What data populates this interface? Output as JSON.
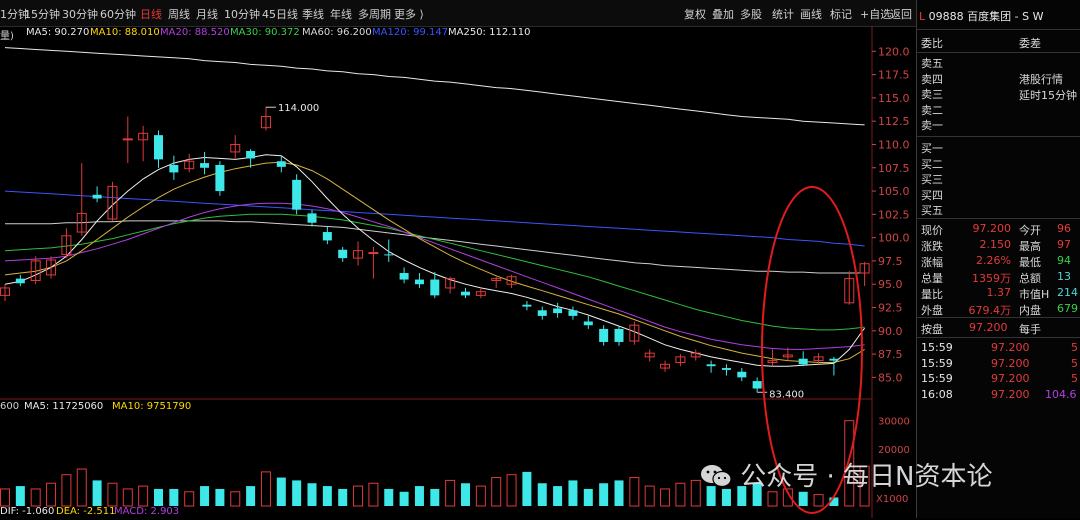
{
  "periods": [
    {
      "label": "1分钟",
      "x": 0,
      "active": false
    },
    {
      "label": "15分钟",
      "x": 24,
      "active": false
    },
    {
      "label": "30分钟",
      "x": 62,
      "active": false
    },
    {
      "label": "60分钟",
      "x": 100,
      "active": false
    },
    {
      "label": "日线",
      "x": 140,
      "active": true
    },
    {
      "label": "周线",
      "x": 168,
      "active": false
    },
    {
      "label": "月线",
      "x": 196,
      "active": false
    },
    {
      "label": "10分钟",
      "x": 224,
      "active": false
    },
    {
      "label": "45日线",
      "x": 262,
      "active": false
    },
    {
      "label": "季线",
      "x": 302,
      "active": false
    },
    {
      "label": "年线",
      "x": 330,
      "active": false
    },
    {
      "label": "多周期",
      "x": 358,
      "active": false
    },
    {
      "label": "更多 ⟩",
      "x": 394,
      "active": false
    }
  ],
  "tools": [
    "复权",
    "叠加",
    "多股",
    "统计",
    "画线",
    "标记",
    "+自选",
    "返回"
  ],
  "ma": {
    "prefix": "量)",
    "ma5": "MA5: 90.270",
    "ma10": "MA10: 88.010",
    "ma20": "MA20: 88.520",
    "ma30": "MA30: 90.372",
    "ma60": "MA60: 96.200",
    "ma120": "MA120: 99.147",
    "ma250": "MA250: 112.110"
  },
  "vol_ma": {
    "vol": "600",
    "ma5": "MA5: 11725060",
    "ma10": "MA10: 9751790"
  },
  "macd": {
    "dif": "DIF: -1.060",
    "dea": "DEA: -2.511",
    "macd": "MACD: 2.903"
  },
  "price_labels": {
    "high": "114.000",
    "low": "83.400"
  },
  "panel": {
    "code": "09888 百度集团 - S W",
    "commission_ratio": "委比",
    "commission_diff": "委差",
    "sell_levels": [
      "卖五",
      "卖四",
      "卖三",
      "卖二",
      "卖一"
    ],
    "buy_levels": [
      "买一",
      "买二",
      "买三",
      "买四",
      "买五"
    ],
    "market_note": "港股行情",
    "delay_note": "延时15分钟",
    "quote": [
      {
        "l1": "现价",
        "v1": "97.200",
        "l2": "今开",
        "v2": "96"
      },
      {
        "l1": "涨跌",
        "v1": "2.150",
        "l2": "最高",
        "v2": "97"
      },
      {
        "l1": "涨幅",
        "v1": "2.26%",
        "l2": "最低",
        "v2": "94"
      },
      {
        "l1": "总量",
        "v1": "1359万",
        "l2": "总额",
        "v2": "13"
      },
      {
        "l1": "量比",
        "v1": "1.37",
        "l2": "市值H",
        "v2": "214"
      },
      {
        "l1": "外盘",
        "v1": "679.4万",
        "l2": "内盘",
        "v2": "679"
      }
    ],
    "auction": {
      "l1": "按盘",
      "v1": "97.200",
      "l2": "每手"
    },
    "ticks": [
      {
        "time": "15:59",
        "price": "97.200",
        "vol": "5"
      },
      {
        "time": "15:59",
        "price": "97.200",
        "vol": "5"
      },
      {
        "time": "15:59",
        "price": "97.200",
        "vol": "5"
      },
      {
        "time": "16:08",
        "price": "97.200",
        "vol": "104.6"
      }
    ]
  },
  "price_axis": [
    "120.0",
    "117.5",
    "115.0",
    "112.5",
    "110.0",
    "107.5",
    "105.0",
    "102.5",
    "100.0",
    "97.5",
    "95.0",
    "92.5",
    "90.0",
    "87.5",
    "85.0"
  ],
  "vol_axis": [
    "30000",
    "20000",
    "X1000"
  ],
  "watermark": "公众号 · 每日N资本论",
  "chart_data": {
    "type": "candlestick",
    "y_range": [
      83,
      121
    ],
    "candles": [
      {
        "o": 93.8,
        "c": 94.6,
        "h": 95.0,
        "l": 93.2
      },
      {
        "o": 95.6,
        "c": 95.1,
        "h": 96.0,
        "l": 94.8
      },
      {
        "o": 95.4,
        "c": 97.5,
        "h": 98.0,
        "l": 95.0
      },
      {
        "o": 96.0,
        "c": 97.6,
        "h": 98.0,
        "l": 95.6
      },
      {
        "o": 98.2,
        "c": 100.2,
        "h": 101.0,
        "l": 97.8
      },
      {
        "o": 100.6,
        "c": 102.6,
        "h": 108.0,
        "l": 100.2
      },
      {
        "o": 104.6,
        "c": 104.2,
        "h": 105.5,
        "l": 103.8
      },
      {
        "o": 102.0,
        "c": 105.5,
        "h": 106.0,
        "l": 101.8
      },
      {
        "o": 110.6,
        "c": 110.6,
        "h": 113.0,
        "l": 108.0
      },
      {
        "o": 110.5,
        "c": 111.2,
        "h": 112.0,
        "l": 108.2
      },
      {
        "o": 111.0,
        "c": 108.4,
        "h": 111.5,
        "l": 107.5
      },
      {
        "o": 107.8,
        "c": 107.0,
        "h": 108.8,
        "l": 106.2
      },
      {
        "o": 107.4,
        "c": 108.2,
        "h": 109.0,
        "l": 107.0
      },
      {
        "o": 108.0,
        "c": 107.5,
        "h": 109.2,
        "l": 106.8
      },
      {
        "o": 107.8,
        "c": 105.0,
        "h": 108.2,
        "l": 104.5
      },
      {
        "o": 109.2,
        "c": 110.0,
        "h": 111.0,
        "l": 108.5
      },
      {
        "o": 109.3,
        "c": 108.5,
        "h": 109.5,
        "l": 107.5
      },
      {
        "o": 111.8,
        "c": 113.0,
        "h": 114.0,
        "l": 111.5
      },
      {
        "o": 108.2,
        "c": 107.6,
        "h": 108.8,
        "l": 107.0
      },
      {
        "o": 106.2,
        "c": 103.0,
        "h": 106.8,
        "l": 102.5
      },
      {
        "o": 102.6,
        "c": 101.6,
        "h": 103.0,
        "l": 101.2
      },
      {
        "o": 100.6,
        "c": 99.7,
        "h": 101.2,
        "l": 99.3
      },
      {
        "o": 98.7,
        "c": 97.8,
        "h": 99.0,
        "l": 97.4
      },
      {
        "o": 97.8,
        "c": 98.6,
        "h": 99.6,
        "l": 97.0
      },
      {
        "o": 98.4,
        "c": 98.4,
        "h": 99.0,
        "l": 95.6
      },
      {
        "o": 98.2,
        "c": 98.1,
        "h": 99.8,
        "l": 97.4
      },
      {
        "o": 96.2,
        "c": 95.5,
        "h": 96.8,
        "l": 95.1
      },
      {
        "o": 95.5,
        "c": 95.0,
        "h": 96.2,
        "l": 94.6
      },
      {
        "o": 95.5,
        "c": 93.8,
        "h": 96.3,
        "l": 93.5
      },
      {
        "o": 94.6,
        "c": 95.6,
        "h": 95.8,
        "l": 94.0
      },
      {
        "o": 94.2,
        "c": 93.8,
        "h": 94.6,
        "l": 93.5
      },
      {
        "o": 93.8,
        "c": 94.2,
        "h": 94.6,
        "l": 93.5
      },
      {
        "o": 95.4,
        "c": 95.6,
        "h": 95.8,
        "l": 94.6
      },
      {
        "o": 95.0,
        "c": 95.8,
        "h": 96.0,
        "l": 94.6
      },
      {
        "o": 92.8,
        "c": 92.6,
        "h": 93.2,
        "l": 92.2
      },
      {
        "o": 92.2,
        "c": 91.6,
        "h": 92.6,
        "l": 91.2
      },
      {
        "o": 92.4,
        "c": 91.9,
        "h": 93.0,
        "l": 91.4
      },
      {
        "o": 92.2,
        "c": 91.6,
        "h": 92.6,
        "l": 91.2
      },
      {
        "o": 91.0,
        "c": 90.6,
        "h": 91.6,
        "l": 90.2
      },
      {
        "o": 90.2,
        "c": 88.8,
        "h": 90.6,
        "l": 88.4
      },
      {
        "o": 90.2,
        "c": 88.8,
        "h": 90.5,
        "l": 88.4
      },
      {
        "o": 88.9,
        "c": 90.6,
        "h": 91.0,
        "l": 88.5
      },
      {
        "o": 87.2,
        "c": 87.6,
        "h": 88.0,
        "l": 86.7
      },
      {
        "o": 86.0,
        "c": 86.4,
        "h": 86.8,
        "l": 85.6
      },
      {
        "o": 86.6,
        "c": 87.2,
        "h": 87.5,
        "l": 86.2
      },
      {
        "o": 87.2,
        "c": 87.6,
        "h": 88.0,
        "l": 86.8
      },
      {
        "o": 86.4,
        "c": 86.2,
        "h": 86.8,
        "l": 85.5
      },
      {
        "o": 86.0,
        "c": 85.8,
        "h": 86.4,
        "l": 85.2
      },
      {
        "o": 85.6,
        "c": 85.0,
        "h": 86.0,
        "l": 84.6
      },
      {
        "o": 84.6,
        "c": 83.8,
        "h": 85.0,
        "l": 83.4
      },
      {
        "o": 86.6,
        "c": 86.8,
        "h": 88.0,
        "l": 86.2
      },
      {
        "o": 87.2,
        "c": 87.4,
        "h": 88.2,
        "l": 86.8
      },
      {
        "o": 87.0,
        "c": 86.4,
        "h": 87.8,
        "l": 86.2
      },
      {
        "o": 86.8,
        "c": 87.2,
        "h": 87.6,
        "l": 86.5
      },
      {
        "o": 87.0,
        "c": 86.8,
        "h": 87.2,
        "l": 85.2
      },
      {
        "o": 93.0,
        "c": 95.6,
        "h": 96.4,
        "l": 92.8
      },
      {
        "o": 96.2,
        "c": 97.2,
        "h": 97.4,
        "l": 94.8
      }
    ],
    "ma5": [
      95.0,
      95.3,
      96.0,
      96.8,
      98.0,
      99.8,
      101.8,
      103.5,
      105.0,
      106.3,
      107.3,
      108.0,
      108.4,
      108.6,
      108.5,
      108.4,
      108.6,
      108.9,
      108.8,
      107.6,
      106.0,
      104.2,
      102.5,
      101.0,
      99.7,
      98.5,
      97.6,
      96.8,
      96.1,
      95.5,
      95.0,
      94.6,
      94.3,
      94.0,
      93.6,
      93.1,
      92.6,
      92.2,
      91.7,
      91.1,
      90.5,
      89.9,
      89.2,
      88.5,
      88.0,
      87.6,
      87.2,
      86.9,
      86.6,
      86.3,
      86.2,
      86.2,
      86.3,
      86.4,
      86.5,
      88.0,
      90.3
    ],
    "ma10": [
      96.0,
      96.2,
      96.4,
      96.8,
      97.5,
      98.6,
      99.8,
      101.0,
      102.2,
      103.3,
      104.3,
      105.2,
      105.9,
      106.5,
      107.0,
      107.4,
      107.7,
      108.0,
      108.1,
      107.8,
      107.2,
      106.3,
      105.2,
      104.1,
      103.0,
      101.9,
      100.9,
      99.9,
      99.0,
      98.1,
      97.3,
      96.6,
      95.9,
      95.3,
      94.8,
      94.3,
      93.8,
      93.3,
      92.8,
      92.3,
      91.8,
      91.2,
      90.6,
      90.0,
      89.4,
      88.9,
      88.4,
      88.0,
      87.6,
      87.3,
      87.0,
      86.8,
      86.7,
      86.6,
      86.6,
      87.0,
      88.0
    ],
    "ma20": [
      97.5,
      97.6,
      97.7,
      97.8,
      98.0,
      98.4,
      98.8,
      99.3,
      99.8,
      100.4,
      101.0,
      101.6,
      102.2,
      102.7,
      103.1,
      103.4,
      103.6,
      103.7,
      103.7,
      103.6,
      103.4,
      103.1,
      102.7,
      102.2,
      101.7,
      101.2,
      100.6,
      100.0,
      99.4,
      98.8,
      98.2,
      97.6,
      97.0,
      96.4,
      95.8,
      95.2,
      94.6,
      94.0,
      93.4,
      92.8,
      92.2,
      91.6,
      91.0,
      90.4,
      89.9,
      89.5,
      89.1,
      88.8,
      88.5,
      88.3,
      88.1,
      88.0,
      88.0,
      88.1,
      88.2,
      88.3,
      88.5
    ],
    "ma30": [
      98.6,
      98.7,
      98.8,
      98.9,
      99.1,
      99.3,
      99.6,
      99.9,
      100.3,
      100.7,
      101.1,
      101.5,
      101.8,
      102.1,
      102.3,
      102.4,
      102.5,
      102.5,
      102.5,
      102.4,
      102.3,
      102.1,
      101.9,
      101.6,
      101.3,
      101.0,
      100.6,
      100.2,
      99.8,
      99.4,
      99.0,
      98.6,
      98.2,
      97.8,
      97.4,
      97.0,
      96.6,
      96.2,
      95.8,
      95.3,
      94.8,
      94.3,
      93.8,
      93.3,
      92.8,
      92.3,
      91.9,
      91.5,
      91.1,
      90.8,
      90.5,
      90.3,
      90.2,
      90.1,
      90.1,
      90.2,
      90.4
    ],
    "ma60": [
      101.5,
      101.5,
      101.5,
      101.5,
      101.6,
      101.6,
      101.7,
      101.7,
      101.8,
      101.8,
      101.8,
      101.8,
      101.8,
      101.8,
      101.8,
      101.7,
      101.7,
      101.6,
      101.5,
      101.4,
      101.3,
      101.2,
      101.1,
      100.9,
      100.7,
      100.5,
      100.3,
      100.1,
      99.9,
      99.7,
      99.5,
      99.3,
      99.1,
      98.9,
      98.7,
      98.5,
      98.3,
      98.1,
      97.9,
      97.7,
      97.5,
      97.3,
      97.2,
      97.0,
      96.9,
      96.8,
      96.7,
      96.6,
      96.5,
      96.4,
      96.4,
      96.3,
      96.3,
      96.2,
      96.2,
      96.2,
      96.2
    ],
    "ma120": [
      105.0,
      104.9,
      104.8,
      104.7,
      104.6,
      104.5,
      104.4,
      104.3,
      104.2,
      104.1,
      104.0,
      103.9,
      103.8,
      103.7,
      103.6,
      103.5,
      103.4,
      103.3,
      103.2,
      103.1,
      103.0,
      102.9,
      102.8,
      102.7,
      102.6,
      102.5,
      102.4,
      102.3,
      102.2,
      102.1,
      102.0,
      101.9,
      101.8,
      101.7,
      101.6,
      101.5,
      101.4,
      101.3,
      101.2,
      101.1,
      101.0,
      100.9,
      100.8,
      100.7,
      100.6,
      100.5,
      100.4,
      100.3,
      100.2,
      100.1,
      100.0,
      99.8,
      99.7,
      99.6,
      99.4,
      99.3,
      99.1
    ],
    "ma250": [
      120.4,
      120.3,
      120.2,
      120.1,
      120.0,
      119.9,
      119.8,
      119.7,
      119.6,
      119.5,
      119.4,
      119.3,
      119.2,
      119.0,
      118.9,
      118.8,
      118.6,
      118.5,
      118.4,
      118.2,
      118.1,
      117.9,
      117.8,
      117.6,
      117.5,
      117.3,
      117.2,
      117.0,
      116.8,
      116.7,
      116.5,
      116.3,
      116.1,
      116.0,
      115.8,
      115.6,
      115.4,
      115.2,
      115.0,
      114.8,
      114.6,
      114.4,
      114.2,
      114.0,
      113.8,
      113.6,
      113.4,
      113.2,
      113.0,
      112.9,
      112.8,
      112.7,
      112.5,
      112.4,
      112.3,
      112.2,
      112.1
    ],
    "volume": [
      6,
      7,
      6,
      8,
      11,
      13,
      9,
      8,
      6,
      7,
      6,
      6,
      5,
      7,
      6,
      5,
      7,
      12,
      10,
      9,
      8,
      7,
      6,
      7,
      8,
      6,
      5,
      7,
      6,
      9,
      8,
      7,
      10,
      11,
      12,
      8,
      7,
      9,
      6,
      8,
      9,
      10,
      7,
      6,
      8,
      9,
      7,
      6,
      7,
      8,
      5,
      6,
      5,
      4,
      3,
      30,
      14
    ],
    "macd": [
      -0.5,
      -0.3,
      0.2,
      0.6,
      1.0,
      1.4,
      1.8,
      2.0,
      2.2,
      2.1,
      1.9,
      1.6,
      1.3,
      1.0,
      0.6,
      0.3,
      0.0,
      -0.4,
      -0.8,
      -1.2,
      -1.6,
      -1.9,
      -2.2,
      -2.4,
      -2.5,
      -2.5,
      -2.4,
      -2.3,
      -2.1,
      -1.9,
      -1.7,
      -1.5,
      -1.3,
      -1.1,
      -0.9,
      -0.8,
      -0.7,
      -0.6,
      -0.5,
      -0.4,
      -0.3,
      -0.2,
      -0.1,
      0.0,
      0.1,
      0.2,
      0.3,
      0.4,
      0.5,
      0.6,
      0.7,
      0.9,
      1.1,
      1.4,
      1.8,
      2.4,
      2.9
    ]
  }
}
